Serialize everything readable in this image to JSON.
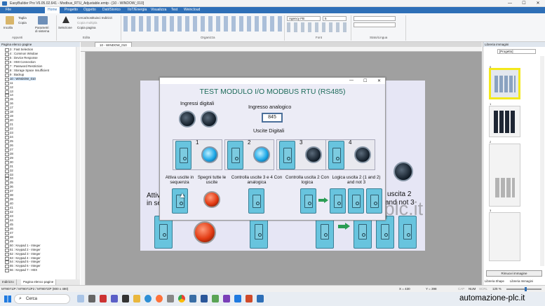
{
  "window": {
    "title": "EasyBuilder Pro V6.05.02.641 - Modbus_RTU_Adjustable.emtp - [10 - WINDOW_010]",
    "minimize": "—",
    "maximize": "☐",
    "close": "✕"
  },
  "menu": [
    "File",
    "Home",
    "Progetto",
    "Oggetto",
    "Dati/Storico",
    "IIoT/Energia",
    "Visualizza",
    "Test",
    "Weincloud"
  ],
  "ribbon": {
    "incolla": "Incolla",
    "taglia": "Taglia",
    "copia": "Copia",
    "parametri": "Parametri di sistema",
    "selezione": "Selezione",
    "cerca": "Cerca/Sostituisci Indirizzi",
    "copia_multipla": "Copia multipla",
    "copia_pagina": "Copia pagina",
    "font_combo": "Agency FB",
    "size_combo": "5",
    "groups": [
      "Appunti",
      "Edita",
      "Organizza",
      "Font",
      "Stato/Lingua"
    ]
  },
  "left_panel": {
    "header": "Pagina elenco pagine",
    "items": [
      "3 : Fast Selection",
      "4 : Common Window",
      "5 : Device Response",
      "6 : HMI Connection",
      "7 : Password Restriction",
      "8 : Storage Space Insufficient",
      "9 : Backup",
      "10 : WINDOW_010",
      "11",
      "12",
      "13",
      "14",
      "15",
      "16",
      "17",
      "18",
      "19",
      "20",
      "21",
      "22",
      "23",
      "24",
      "25",
      "26",
      "27",
      "28",
      "29",
      "30",
      "31",
      "32",
      "33",
      "34",
      "35",
      "36",
      "37",
      "38",
      "39",
      "40",
      "41",
      "42",
      "43",
      "44",
      "45",
      "46",
      "47",
      "48",
      "49",
      "50 : Keypad 1 - Integer",
      "51 : Keypad 2 - Integer",
      "52 : Keypad 3 - Integer",
      "53 : Keypad 4 - Integer",
      "54 : Keypad 5 - Integer",
      "55 : Keypad 6 - Integer",
      "56 : Keypad 7 - HEX"
    ],
    "tabs": [
      "Indirizzo",
      "Pagina elenco pagine"
    ]
  },
  "editor": {
    "tab": "10 - WINDOW_010"
  },
  "dialog": {
    "title": "TEST MODULO I/O MODBUS RTU (RS485)",
    "ingressi_digitali": "Ingressi digitali",
    "ingresso_analogico": "Ingresso analogico",
    "analog_value": "845",
    "uscite_digitali": "Uscite Digitali",
    "output_numbers": [
      "1",
      "2",
      "3",
      "4"
    ],
    "lbl_attiva": "Attiva uscite in sequenza",
    "lbl_spegni": "Spegni tutte le uscite",
    "lbl_ctrl34": "Controlla uscite 3 e 4 Con analogica",
    "lbl_ctrl2": "Controlla uscita 2 Con logica",
    "lbl_logica": "Logica uscita 2 (1 and 2) and not 3",
    "min": "—",
    "max": "☐",
    "close": "✕"
  },
  "background": {
    "attiva": "Attiv",
    "in_se": "in se",
    "uscita2": "uscita 2",
    "and_not": "and not 3",
    "watermark": "automazione-plc.it"
  },
  "right_panel": {
    "header": "Libreria immagini",
    "combo": "[Progetto]",
    "thumb_labels": [
      "0",
      "1",
      "2",
      "3"
    ],
    "ricerca": "Rimuovi immagine",
    "tabs": [
      "Libreria Shape",
      "Libreria Immagini"
    ]
  },
  "status": {
    "model": "MT8071iP / MT8071iP2 / MT8072iP (800 x 480)",
    "x": "X = 430",
    "y": "Y = 398",
    "caps": "CAP",
    "num": "NUM",
    "scrl": "SCRL",
    "zoom": "125 %"
  },
  "taskbar": {
    "search": "Cerca",
    "brand": "automazione-plc.it"
  },
  "colors": {
    "menubar": "#2e6fb7",
    "switch": "#68c4de",
    "lamp_on": "#1fa9e8",
    "red": "#e23a12",
    "title_green": "#1d6b5a"
  }
}
